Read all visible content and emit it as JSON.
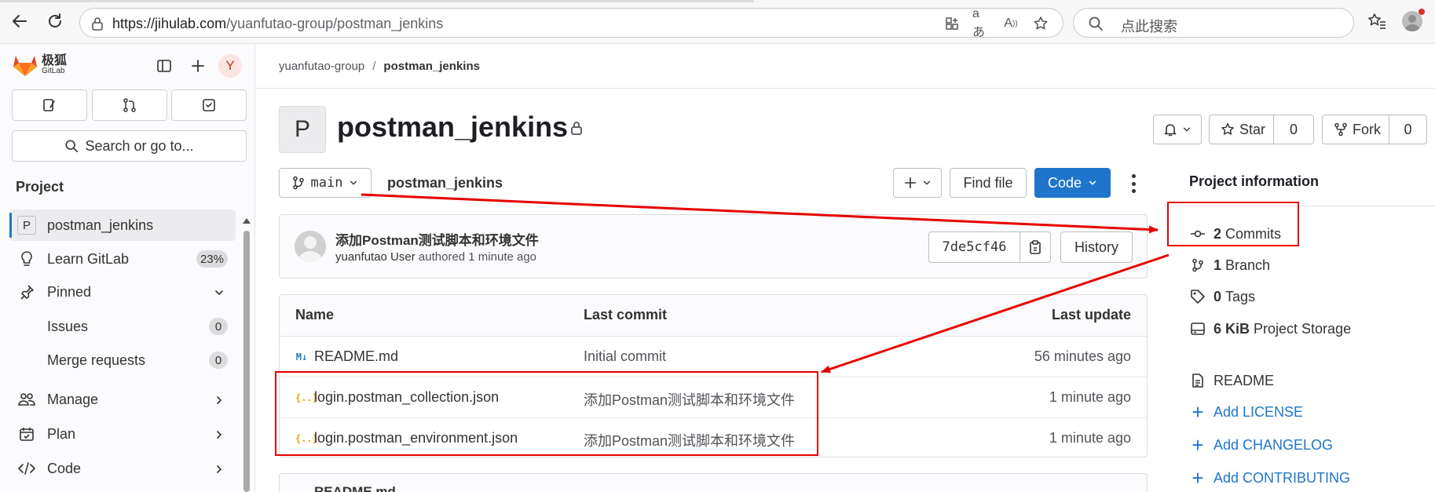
{
  "browser": {
    "url_host": "https://jihulab.com",
    "url_path": "/yuanfutao-group/postman_jenkins",
    "search_placeholder": "点此搜索"
  },
  "sidebar": {
    "logo_cn": "极狐",
    "logo_en": "GitLab",
    "avatar_letter": "Y",
    "search_label": "Search or go to...",
    "section_title": "Project",
    "items": [
      {
        "label": "postman_jenkins",
        "tile": "P"
      },
      {
        "label": "Learn GitLab",
        "badge": "23%"
      },
      {
        "label": "Pinned"
      },
      {
        "label": "Issues",
        "badge": "0"
      },
      {
        "label": "Merge requests",
        "badge": "0"
      },
      {
        "label": "Manage"
      },
      {
        "label": "Plan"
      },
      {
        "label": "Code"
      }
    ]
  },
  "breadcrumb": {
    "group": "yuanfutao-group",
    "separator": "/",
    "project": "postman_jenkins"
  },
  "project": {
    "avatar_letter": "P",
    "title": "postman_jenkins",
    "star_label": "Star",
    "star_count": "0",
    "fork_label": "Fork",
    "fork_count": "0"
  },
  "toolbar": {
    "branch": "main",
    "path": "postman_jenkins",
    "find_file": "Find file",
    "code_label": "Code"
  },
  "last_commit": {
    "title": "添加Postman测试脚本和环境文件",
    "author": "yuanfutao User",
    "action": "authored",
    "time": "1 minute ago",
    "sha": "7de5cf46",
    "history_label": "History"
  },
  "files": {
    "headers": {
      "name": "Name",
      "last_commit": "Last commit",
      "last_update": "Last update"
    },
    "rows": [
      {
        "name": "README.md",
        "icon": "M↓",
        "commit": "Initial commit",
        "updated": "56 minutes ago"
      },
      {
        "name": "login.postman_collection.json",
        "icon": "{..}",
        "commit": "添加Postman测试脚本和环境文件",
        "updated": "1 minute ago"
      },
      {
        "name": "login.postman_environment.json",
        "icon": "{..}",
        "commit": "添加Postman测试脚本和环境文件",
        "updated": "1 minute ago"
      }
    ]
  },
  "readme_header": "README.md",
  "project_info": {
    "title": "Project information",
    "commits": {
      "count": "2",
      "label": "Commits"
    },
    "branches": {
      "count": "1",
      "label": "Branch"
    },
    "tags": {
      "count": "0",
      "label": "Tags"
    },
    "storage": {
      "count": "6 KiB",
      "label": "Project Storage"
    },
    "readme": "README",
    "add_license": "Add LICENSE",
    "add_changelog": "Add CHANGELOG",
    "add_contributing": "Add CONTRIBUTING"
  },
  "colors": {
    "primary": "#1f75cb",
    "annotation": "#e60000"
  }
}
